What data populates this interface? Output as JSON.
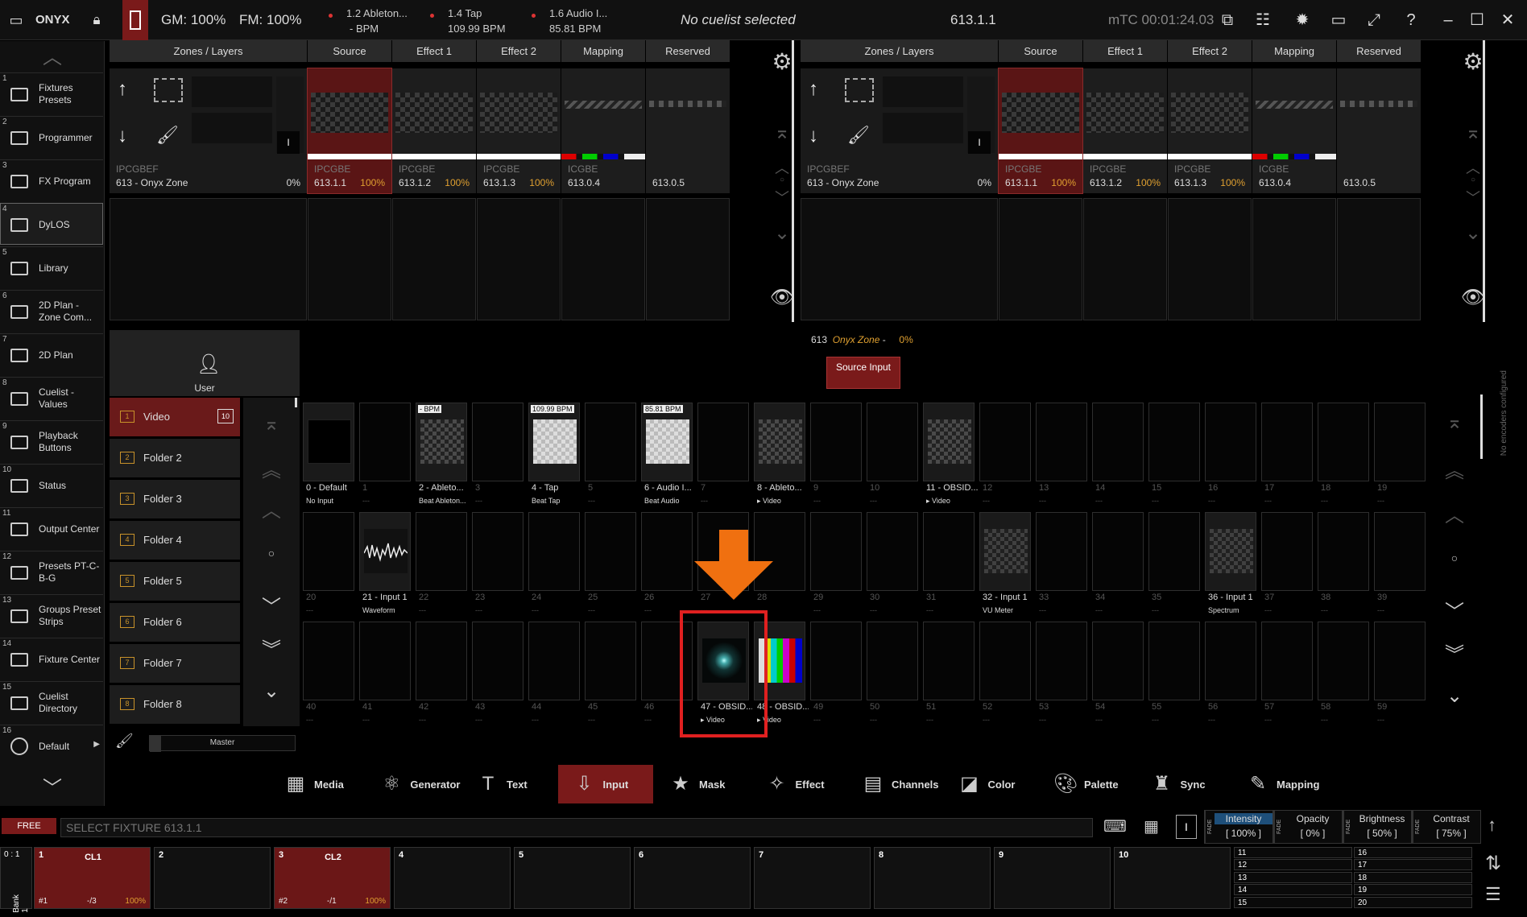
{
  "app": {
    "name": "ONYX",
    "gm": "GM: 100%",
    "fm": "FM: 100%",
    "cuelist": "No cuelist selected",
    "fixture_id": "613.1.1",
    "mtc": "mTC 00:01:24.03"
  },
  "cues": [
    {
      "title": "1.2 Ableton...",
      "sub": "- BPM"
    },
    {
      "title": "1.4 Tap",
      "sub": "109.99 BPM"
    },
    {
      "title": "1.6 Audio I...",
      "sub": "85.81 BPM"
    }
  ],
  "sidebar": [
    {
      "num": "1",
      "label": "Fixtures Presets"
    },
    {
      "num": "2",
      "label": "Programmer"
    },
    {
      "num": "3",
      "label": "FX Program"
    },
    {
      "num": "4",
      "label": "DyLOS"
    },
    {
      "num": "5",
      "label": "Library"
    },
    {
      "num": "6",
      "label": "2D Plan - Zone Com..."
    },
    {
      "num": "7",
      "label": "2D Plan"
    },
    {
      "num": "8",
      "label": "Cuelist - Values"
    },
    {
      "num": "9",
      "label": "Playback Buttons"
    },
    {
      "num": "10",
      "label": "Status"
    },
    {
      "num": "11",
      "label": "Output Center"
    },
    {
      "num": "12",
      "label": "Presets PT-C-B-G"
    },
    {
      "num": "13",
      "label": "Groups Preset Strips"
    },
    {
      "num": "14",
      "label": "Fixture Center"
    },
    {
      "num": "15",
      "label": "Cuelist Directory"
    },
    {
      "num": "16",
      "label": "Default"
    }
  ],
  "layer_headers": [
    "Zones / Layers",
    "Source",
    "Effect 1",
    "Effect 2",
    "Mapping",
    "Reserved"
  ],
  "layer_slots": [
    {
      "t1": "IPCGBE",
      "t2": "613.1.1",
      "pct": "100%"
    },
    {
      "t1": "IPCGBE",
      "t2": "613.1.2",
      "pct": "100%"
    },
    {
      "t1": "IPCGBE",
      "t2": "613.1.3",
      "pct": "100%"
    },
    {
      "t1": "ICGBE",
      "t2": "613.0.4",
      "pct": ""
    },
    {
      "t1": "",
      "t2": "613.0.5",
      "pct": ""
    }
  ],
  "zone": {
    "type": "IPCGBEF",
    "name": "613 - Onyx Zone",
    "pct": "0%",
    "btn": "I"
  },
  "status_line": {
    "num": "613",
    "zone": "Onyx Zone",
    "sep": "-",
    "pct": "0%"
  },
  "source_input_button": "Source Input",
  "user_label": "User",
  "folders": [
    {
      "n": "1",
      "label": "Video",
      "count": "10"
    },
    {
      "n": "2",
      "label": "Folder 2"
    },
    {
      "n": "3",
      "label": "Folder 3"
    },
    {
      "n": "4",
      "label": "Folder 4"
    },
    {
      "n": "5",
      "label": "Folder 5"
    },
    {
      "n": "6",
      "label": "Folder 6"
    },
    {
      "n": "7",
      "label": "Folder 7"
    },
    {
      "n": "8",
      "label": "Folder 8"
    }
  ],
  "grid": {
    "row0": [
      {
        "n": "0 - Default",
        "s": "No Input"
      },
      {
        "n": "1",
        "s": "---"
      },
      {
        "n": "2 - Ableto...",
        "s": "Beat Ableton...",
        "tag": "- BPM"
      },
      {
        "n": "3",
        "s": "---"
      },
      {
        "n": "4 - Tap",
        "s": "Beat Tap",
        "tag": "109.99 BPM"
      },
      {
        "n": "5",
        "s": "---"
      },
      {
        "n": "6 - Audio I...",
        "s": "Beat Audio",
        "tag": "85.81 BPM"
      },
      {
        "n": "7",
        "s": "---"
      },
      {
        "n": "8 - Ableto...",
        "s": "▸ Video"
      },
      {
        "n": "9",
        "s": "---"
      },
      {
        "n": "10",
        "s": "---"
      },
      {
        "n": "11 - OBSID...",
        "s": "▸ Video"
      },
      {
        "n": "12",
        "s": "---"
      },
      {
        "n": "13",
        "s": "---"
      },
      {
        "n": "14",
        "s": "---"
      },
      {
        "n": "15",
        "s": "---"
      },
      {
        "n": "16",
        "s": "---"
      },
      {
        "n": "17",
        "s": "---"
      },
      {
        "n": "18",
        "s": "---"
      },
      {
        "n": "19",
        "s": "---"
      }
    ],
    "row1": [
      {
        "n": "20",
        "s": "---"
      },
      {
        "n": "21 - Input 1",
        "s": "Waveform"
      },
      {
        "n": "22",
        "s": "---"
      },
      {
        "n": "23",
        "s": "---"
      },
      {
        "n": "24",
        "s": "---"
      },
      {
        "n": "25",
        "s": "---"
      },
      {
        "n": "26",
        "s": "---"
      },
      {
        "n": "27",
        "s": "---"
      },
      {
        "n": "28",
        "s": "---"
      },
      {
        "n": "29",
        "s": "---"
      },
      {
        "n": "30",
        "s": "---"
      },
      {
        "n": "31",
        "s": "---"
      },
      {
        "n": "32 - Input 1",
        "s": "VU Meter"
      },
      {
        "n": "33",
        "s": "---"
      },
      {
        "n": "34",
        "s": "---"
      },
      {
        "n": "35",
        "s": "---"
      },
      {
        "n": "36 - Input 1",
        "s": "Spectrum"
      },
      {
        "n": "37",
        "s": "---"
      },
      {
        "n": "38",
        "s": "---"
      },
      {
        "n": "39",
        "s": "---"
      }
    ],
    "row2": [
      {
        "n": "40",
        "s": "---"
      },
      {
        "n": "41",
        "s": "---"
      },
      {
        "n": "42",
        "s": "---"
      },
      {
        "n": "43",
        "s": "---"
      },
      {
        "n": "44",
        "s": "---"
      },
      {
        "n": "45",
        "s": "---"
      },
      {
        "n": "46",
        "s": "---"
      },
      {
        "n": "47 - OBSID...",
        "s": "▸ Video"
      },
      {
        "n": "48 - OBSID...",
        "s": "▸ Video"
      },
      {
        "n": "49",
        "s": "---"
      },
      {
        "n": "50",
        "s": "---"
      },
      {
        "n": "51",
        "s": "---"
      },
      {
        "n": "52",
        "s": "---"
      },
      {
        "n": "53",
        "s": "---"
      },
      {
        "n": "54",
        "s": "---"
      },
      {
        "n": "55",
        "s": "---"
      },
      {
        "n": "56",
        "s": "---"
      },
      {
        "n": "57",
        "s": "---"
      },
      {
        "n": "58",
        "s": "---"
      },
      {
        "n": "59",
        "s": "---"
      }
    ]
  },
  "master_label": "Master",
  "no_encoders": "No encoders configured",
  "toolbar": [
    "Media",
    "Generator",
    "Text",
    "Input",
    "Mask",
    "Effect",
    "Channels",
    "Color",
    "Palette",
    "Sync",
    "Mapping"
  ],
  "command": {
    "mode": "FREE",
    "placeholder": "SELECT FIXTURE 613.1.1"
  },
  "params": [
    {
      "name": "Intensity",
      "value": "[ 100% ]"
    },
    {
      "name": "Opacity",
      "value": "[ 0% ]"
    },
    {
      "name": "Brightness",
      "value": "[ 50% ]"
    },
    {
      "name": "Contrast",
      "value": "[ 75% ]"
    }
  ],
  "fade_label": "FADE",
  "bank": {
    "label": "Bank 1",
    "pos": "0 : 1"
  },
  "playbacks": [
    {
      "n": "1",
      "title": "CL1",
      "left": "#1",
      "mid": "-/3",
      "right": "100%"
    },
    {
      "n": "2"
    },
    {
      "n": "3",
      "title": "CL2",
      "left": "#2",
      "mid": "-/1",
      "right": "100%"
    },
    {
      "n": "4"
    },
    {
      "n": "5"
    },
    {
      "n": "6"
    },
    {
      "n": "7"
    },
    {
      "n": "8"
    },
    {
      "n": "9"
    },
    {
      "n": "10"
    }
  ],
  "sub_buttons": [
    "11",
    "12",
    "13",
    "14",
    "15",
    "16",
    "17",
    "18",
    "19",
    "20"
  ],
  "colors": {
    "accent_red": "#7a1a1a",
    "highlight_arrow": "#f07010",
    "highlight_box": "#e02020"
  }
}
